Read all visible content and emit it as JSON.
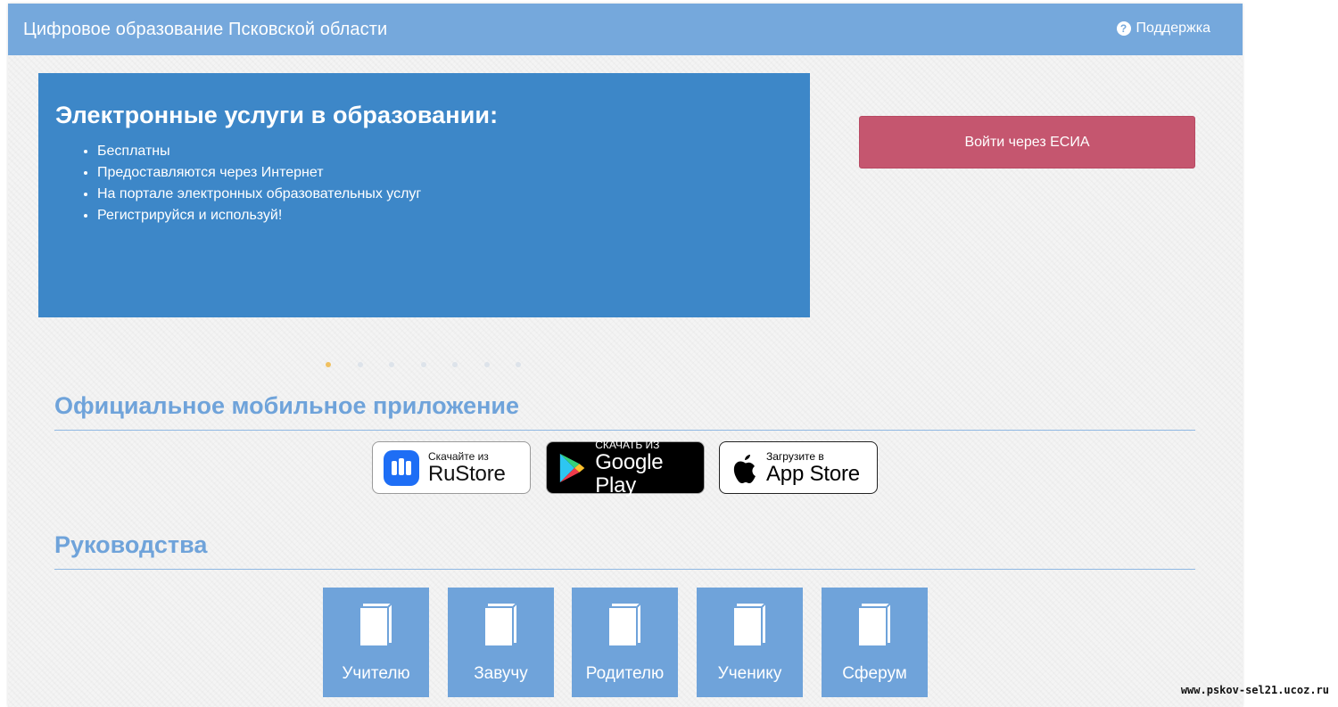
{
  "header": {
    "site_title": "Цифровое образование Псковской области",
    "support_label": "Поддержка"
  },
  "banner": {
    "title": "Электронные услуги в образовании:",
    "items": [
      "Бесплатны",
      "Предоставляются через Интернет",
      "На портале электронных образовательных услуг",
      "Регистрируйся и используй!"
    ],
    "active_slide": 1,
    "slide_count": 7
  },
  "login": {
    "esia_button_label": "Войти через ЕСИА"
  },
  "mobile_app": {
    "title": "Официальное мобильное приложение",
    "stores": [
      {
        "small": "Скачайте из",
        "big": "RuStore",
        "icon": "rustore-icon"
      },
      {
        "small": "СКАЧАТЬ ИЗ",
        "big": "Google Play",
        "icon": "google-play-icon"
      },
      {
        "small": "Загрузите в",
        "big": "App Store",
        "icon": "apple-icon"
      }
    ]
  },
  "guides": {
    "title": "Руководства",
    "items": [
      {
        "label": "Учителю",
        "icon": "book-icon"
      },
      {
        "label": "Завучу",
        "icon": "book-icon"
      },
      {
        "label": "Родителю",
        "icon": "book-icon"
      },
      {
        "label": "Ученику",
        "icon": "book-icon"
      },
      {
        "label": "Сферум",
        "icon": "book-icon"
      }
    ]
  },
  "watermark": "www.pskov-sel21.ucoz.ru",
  "colors": {
    "header": "#75a8dc",
    "banner": "#3d87c8",
    "esia_button": "#c5566f",
    "section_title": "#6fa3da",
    "active_dot": "#f0c060"
  }
}
